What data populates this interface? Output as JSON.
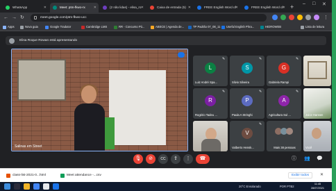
{
  "browser": {
    "tabs": [
      {
        "label": "WhatsApp",
        "active": false,
        "favicon_color": "#25d366"
      },
      {
        "label": "Meet: ptm-fkwo-rx",
        "active": true,
        "favicon_color": "#00897b"
      },
      {
        "label": "(2 não lidas) - elisa_ro",
        "active": false,
        "favicon_color": "#6d3fbf"
      },
      {
        "label": "Caixa de entrada (5)",
        "active": false,
        "favicon_color": "#ea4335"
      },
      {
        "label": "FREE English Word of",
        "active": false,
        "favicon_color": "#1a73e8"
      },
      {
        "label": "FREE English Word of",
        "active": false,
        "favicon_color": "#1a73e8"
      }
    ],
    "url": "meet.google.com/ptm-fkwo-ucc",
    "bookmarks": [
      {
        "label": "Apps",
        "color": "#8ab4f8"
      },
      {
        "label": "Nova guia",
        "color": "#9aa0a6"
      },
      {
        "label": "Google Tradutor",
        "color": "#4285f4"
      },
      {
        "label": "Cambridge LMS",
        "color": "#c62828"
      },
      {
        "label": "RR - Concurso Pú...",
        "color": "#2e7d32"
      },
      {
        "label": "ABECE | Agenda de...",
        "color": "#f9a825"
      },
      {
        "label": "TP Padrão 07_08_11",
        "color": "#1565c0"
      },
      {
        "label": "Useful English Phra...",
        "color": "#1a73e8"
      },
      {
        "label": "HIDROWEB",
        "color": "#00838f"
      },
      {
        "label": "Lista de leitura",
        "color": "#9aa0a6"
      }
    ]
  },
  "meet": {
    "presenting_text": "Elisa Roque Rowan está apresentando",
    "main_speaker": "Salinas em Street",
    "participants": [
      {
        "name": "Luiz André Spa...",
        "initial": "L",
        "color": "#0b8043",
        "video": false
      },
      {
        "name": "Silvio Silveira",
        "initial": "S",
        "color": "#0097a7",
        "video": false
      },
      {
        "name": "Gabriela Rampi",
        "initial": "G",
        "color": "#d93025",
        "video": false
      },
      {
        "name": "",
        "initial": "",
        "color": "#5f6368",
        "video": true,
        "scene": "window"
      },
      {
        "name": "Rogério Tadeu ...",
        "initial": "R",
        "color": "#7b1fa2",
        "video": false
      },
      {
        "name": "Paula A Stringhi",
        "initial": "P",
        "color": "#5c6bc0",
        "video": false
      },
      {
        "name": "Agricultura Sul ...",
        "initial": "A",
        "color": "#8e24aa",
        "video": false
      },
      {
        "name": "Joice Hansen",
        "initial": "",
        "color": "#5f6368",
        "video": true,
        "scene": "board"
      },
      {
        "name": "",
        "initial": "",
        "color": "#5f6368",
        "video": true,
        "scene": "man"
      },
      {
        "name": "Valberto Hensk...",
        "initial": "V",
        "color": "#6d4c41",
        "video": false
      },
      {
        "name": "Mais 38 pessoas",
        "initial": "",
        "color": "#5f6368",
        "video": false
      },
      {
        "name": "Você",
        "initial": "",
        "color": "#5f6368",
        "video": true,
        "scene": "self"
      }
    ],
    "controls": {
      "mic": "mic-off",
      "camera": "camera-off",
      "captions": "CC",
      "present": "present",
      "more": "more",
      "leave": "leave call"
    }
  },
  "downloads": [
    {
      "name": "class-list-2021-0...html",
      "color": "#e65100"
    },
    {
      "name": "Meet attendance -...csv",
      "color": "#0f9d58"
    }
  ],
  "downloads_show_all": "Exibir todos",
  "taskbar": {
    "weather": "20°C Ensolarado",
    "lang": "POR PTB2",
    "time": "11:45",
    "date": "28/07/2021"
  }
}
